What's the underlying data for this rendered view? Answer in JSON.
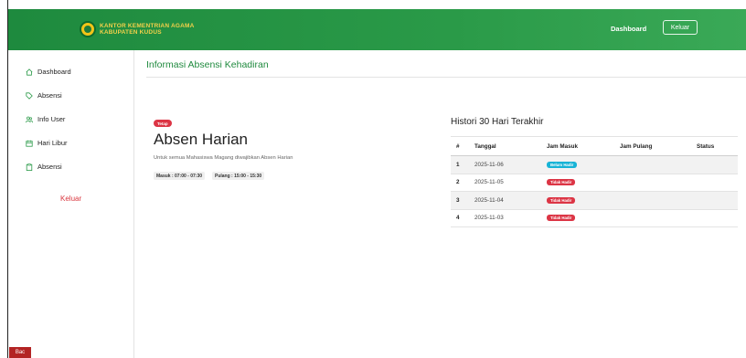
{
  "header": {
    "org_line1": "KANTOR KEMENTRIAN AGAMA",
    "org_line2": "KABUPATEN KUDUS",
    "nav_dashboard": "Dashboard",
    "logout_button": "Keluar"
  },
  "sidebar": {
    "items": [
      {
        "label": "Dashboard",
        "icon": "home-icon"
      },
      {
        "label": "Absensi",
        "icon": "tag-icon"
      },
      {
        "label": "Info User",
        "icon": "users-icon"
      },
      {
        "label": "Hari Libur",
        "icon": "calendar-icon"
      },
      {
        "label": "Absensi",
        "icon": "clipboard-icon"
      }
    ],
    "logout": "Keluar",
    "corner_button": "Bac"
  },
  "main": {
    "title": "Informasi Absensi Kehadiran",
    "badge": "Tetap",
    "absen_title": "Absen Harian",
    "absen_subtitle": "Untuk semua Mahasiswa Magang diwajibkan Absen Harian",
    "masuk_time": "Masuk : 07:00 - 07:30",
    "pulang_time": "Pulang : 15:00 - 15:30"
  },
  "history": {
    "title": "Histori 30 Hari Terakhir",
    "columns": [
      "#",
      "Tanggal",
      "Jam Masuk",
      "Jam Pulang",
      "Status"
    ],
    "rows": [
      {
        "no": "1",
        "tanggal": "2025-11-06",
        "jam_masuk": "Belum Hadir",
        "jam_pulang": "",
        "status": "",
        "badge_color": "#17b3d6"
      },
      {
        "no": "2",
        "tanggal": "2025-11-05",
        "jam_masuk": "Tidak Hadir",
        "jam_pulang": "",
        "status": "",
        "badge_color": "#dc3545"
      },
      {
        "no": "3",
        "tanggal": "2025-11-04",
        "jam_masuk": "Tidak Hadir",
        "jam_pulang": "",
        "status": "",
        "badge_color": "#dc3545"
      },
      {
        "no": "4",
        "tanggal": "2025-11-03",
        "jam_masuk": "Tidak Hadir",
        "jam_pulang": "",
        "status": "",
        "badge_color": "#dc3545"
      }
    ]
  },
  "colors": {
    "brand_green": "#2a9a48",
    "title_green": "#1f8a3e",
    "danger": "#dc3545",
    "info": "#17b3d6"
  }
}
